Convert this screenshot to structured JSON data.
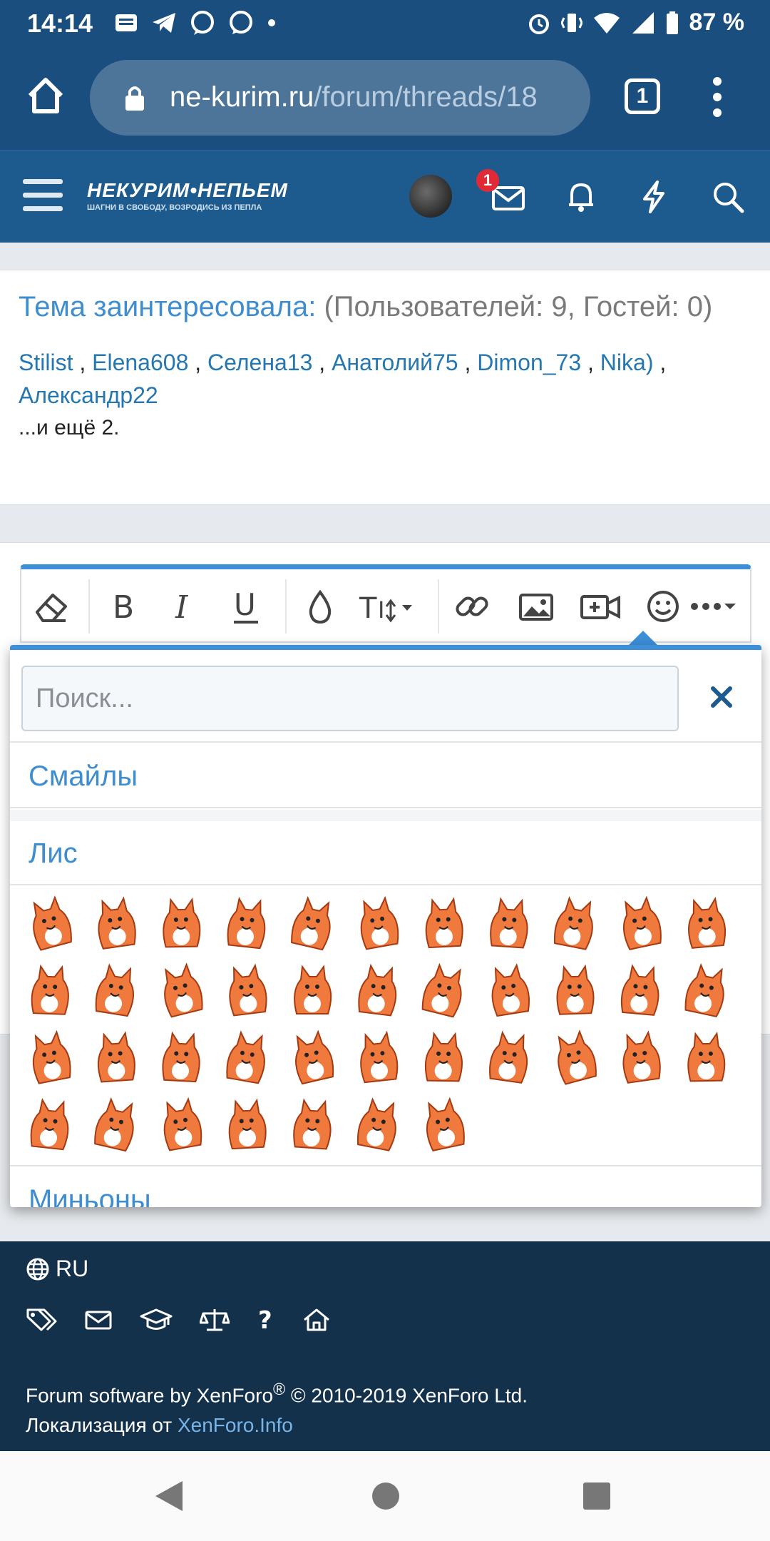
{
  "status_bar": {
    "time": "14:14",
    "battery": "87 %"
  },
  "browser": {
    "url_host": "ne-kurim.ru",
    "url_path": "/forum/threads/18",
    "tab_count": "1"
  },
  "header": {
    "logo_text": "НЕКУРИМ•НЕПЬЕМ",
    "logo_subtitle": "ШАГНИ В СВОБОДУ, ВОЗРОДИСЬ ИЗ ПЕПЛА",
    "messages_badge": "1"
  },
  "viewers": {
    "title": "Тема заинтересовала:",
    "counts": " (Пользователей: 9, Гостей: 0)",
    "users": [
      "Stilist",
      "Elena608",
      "Селена13",
      "Анатолий75",
      "Dimon_73",
      "Nika)",
      "Александр22"
    ],
    "more": "...и ещё 2."
  },
  "emoji_popup": {
    "search_placeholder": "Поиск...",
    "categories": [
      "Смайлы",
      "Лис",
      "Миньоны"
    ],
    "sticker_count": 40
  },
  "footer": {
    "language": "RU",
    "credit_line1": "Forum software by XenForo",
    "credit_reg": "®",
    "credit_line1_end": " © 2010-2019 XenForo Ltd.",
    "credit_line2": "Локализация от ",
    "credit_link": "XenForo.Info"
  },
  "colors": {
    "accent": "#3f8dd1",
    "header_bg": "#1d5b8f",
    "footer_bg": "#14314c",
    "fox": "#f07a3e"
  }
}
